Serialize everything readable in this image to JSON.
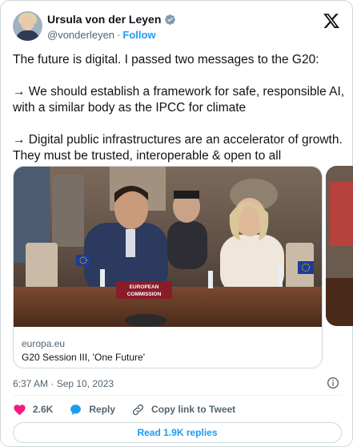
{
  "author": {
    "name": "Ursula von der Leyen",
    "handle": "@vonderleyen",
    "separator": "·",
    "follow_label": "Follow"
  },
  "tweet": {
    "paragraphs": [
      "The future is digital. I passed two messages to the G20:",
      "→ We should establish a framework for safe, responsible AI, with a similar body as the IPCC for climate",
      "→ Digital public infrastructures are an accelerator of growth. They must be trusted, interoperable & open to all"
    ]
  },
  "link_card": {
    "domain": "europa.eu",
    "title": "G20 Session III, 'One Future'",
    "photo_placard": [
      "EUROPEAN",
      "COMMISSION"
    ]
  },
  "meta": {
    "timestamp": "6:37 AM · Sep 10, 2023"
  },
  "actions": {
    "likes": "2.6K",
    "reply_label": "Reply",
    "copy_label": "Copy link to Tweet"
  },
  "replies_button": "Read 1.9K replies",
  "colors": {
    "accent": "#1d9bf0",
    "like": "#f91880",
    "text": "#0f1419",
    "muted": "#536471"
  }
}
